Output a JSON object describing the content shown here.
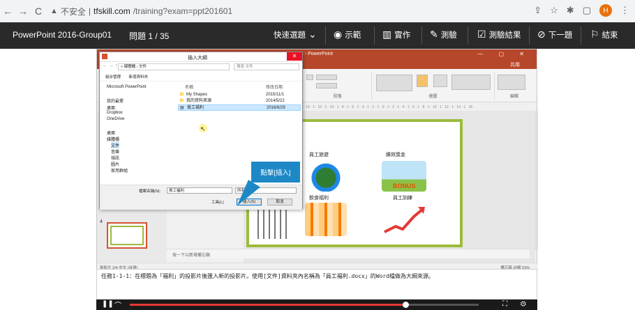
{
  "browser": {
    "security_label": "不安全",
    "host": "tfskill.com",
    "path": "/training?exam=ppt201601",
    "profile_initial": "H"
  },
  "exam_bar": {
    "title": "PowerPoint 2016-Group01",
    "question": "問題 1 / 35",
    "quick_select": "快速選題",
    "demo": "示範",
    "practice": "實作",
    "test": "測驗",
    "result": "測驗結果",
    "next": "下一題",
    "finish": "結束"
  },
  "ppt": {
    "window_title": "1 - PowerPoint",
    "share": "共用",
    "ribbon_groups": [
      "段落",
      "繪圖",
      "編輯"
    ],
    "ruler_text": "16 · 1 · 14 · 1 · 12 · 1 · 10 · 1 · 8 · 1 · 6 · 1 · 4 · 1 · 2 · 1 · 0 · 1 · 2 · 1 · 4 · 1 · 6 · 1 · 8 · 1 · 10 · 1 · 12 · 1 · 14 · 1 · 16",
    "thumb_number": "4",
    "notes_placeholder": "按一下以新增備忘稿",
    "status_left": "投影片 2/4   中文 (台灣)",
    "status_right": "備忘稿   註解   53%",
    "slide_labels": {
      "employee_travel": "員工旅遊",
      "bonus": "績效獎金",
      "meal_welfare": "飲食福利",
      "training": "員工訓練"
    },
    "bonus_text": "BONUS"
  },
  "dialog": {
    "title": "插入大綱",
    "address": "« 媒體櫃 › 文件",
    "search_placeholder": "搜尋 文件",
    "organize": "組合管理",
    "new_folder": "新增資料夾",
    "tree": [
      "Microsoft PowerPoint",
      "我的最愛",
      "桌面",
      "Dropbox",
      "OneDrive",
      "桌面",
      "媒體櫃",
      "文件",
      "音樂",
      "視訊",
      "圖片",
      "家用群組"
    ],
    "col_name": "名稱",
    "col_date": "修改日期",
    "files": [
      {
        "name": "My Shapes",
        "date": "2015/11/1"
      },
      {
        "name": "我的資料來源",
        "date": "2014/5/22"
      },
      {
        "name": "員工福利",
        "date": "2016/6/29"
      }
    ],
    "filename_label": "檔案名稱(N):",
    "filename_value": "員工福利",
    "filetype": "所有大綱",
    "tools": "工具(L)",
    "insert": "插入(S)",
    "cancel": "取消"
  },
  "callout": "點擊[插入]",
  "task": "任務1-1-1：在標題為「福利」的投影片後匯入新的投影片。使用[文件]資料夾內名稱為「員工福利.docx」的Word檔做為大綱來源。",
  "video": {
    "progress": 0.79
  }
}
